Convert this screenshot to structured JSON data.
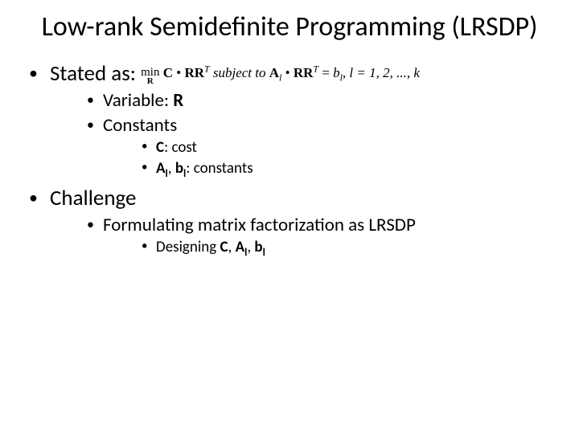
{
  "title": "Low-rank Semidefinite Programming (LRSDP)",
  "b1": {
    "stated": "Stated as:",
    "math": {
      "min": "min",
      "R": "R",
      "C": "C",
      "dot1": " • ",
      "RR": "RR",
      "T": "T",
      "subj": "  subject to  ",
      "A": "A",
      "l": "l",
      "dot2": " • ",
      "eq": " = ",
      "b": "b",
      "comma": ", ",
      "lset": "l = 1, 2, ..., k"
    },
    "variable_pre": "Variable: ",
    "variable_R": "R",
    "constants": "Constants",
    "c_pre": "C",
    "c_post": ": cost",
    "ab_A": "A",
    "ab_l1": "l",
    "ab_sep": ", ",
    "ab_b": "b",
    "ab_l2": "l",
    "ab_post": ": constants"
  },
  "b2": {
    "challenge": "Challenge",
    "formulating": "Formulating matrix factorization as LRSDP",
    "design_pre": "Designing ",
    "design_C": "C",
    "design_s1": ", ",
    "design_A": "A",
    "design_l1": "l",
    "design_s2": ", ",
    "design_b": "b",
    "design_l2": "l"
  }
}
